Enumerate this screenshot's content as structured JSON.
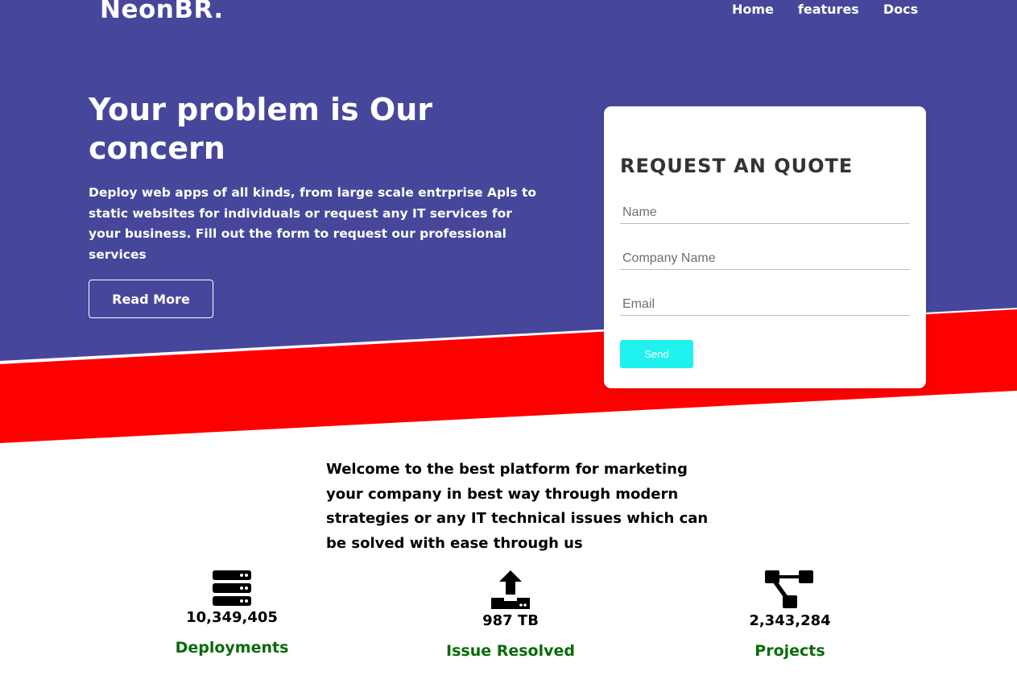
{
  "colors": {
    "hero": "#46479b",
    "stripe": "#ff0000",
    "send_button": "#1ff1ee",
    "stat_label": "#0a6b0a"
  },
  "brand": "NeonBR.",
  "nav": {
    "items": [
      "Home",
      "features",
      "Docs"
    ]
  },
  "hero": {
    "headline": "Your problem is Our concern",
    "subtext": "Deploy web apps of all kinds, from large scale entrprise Apls to static websites for individuals or request any IT services for your business. Fill out the form to request our professional services",
    "read_more_label": "Read More"
  },
  "quote": {
    "title": "REQUEST AN QUOTE",
    "name_placeholder": "Name",
    "company_placeholder": "Company Name",
    "email_placeholder": "Email",
    "send_label": "Send"
  },
  "welcome": "Welcome to the best platform for marketing your company in best way through modern strategies or any IT technical issues which can be solved with ease through us",
  "stats": [
    {
      "icon": "server-icon",
      "value": "10,349,405",
      "label": "Deployments"
    },
    {
      "icon": "upload-icon",
      "value": "987 TB",
      "label": "Issue Resolved"
    },
    {
      "icon": "sitemap-icon",
      "value": "2,343,284",
      "label": "Projects"
    }
  ]
}
